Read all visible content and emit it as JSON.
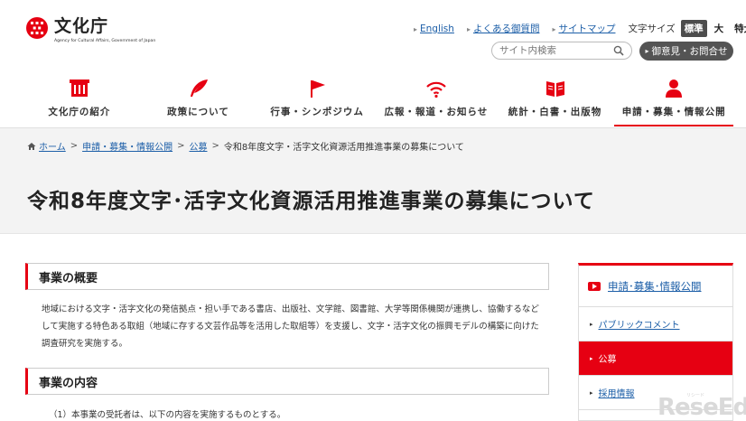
{
  "logo": {
    "jp": "文化庁",
    "en": "Agency for Cultural Affairs, Government of Japan"
  },
  "header": {
    "links": [
      "English",
      "よくある御質問",
      "サイトマップ"
    ],
    "font_size_label": "文字サイズ",
    "font_sizes": [
      "標準",
      "大",
      "特大"
    ],
    "search_placeholder": "サイト内検索",
    "opinion_button": "御意見・お問合せ"
  },
  "gnav": {
    "items": [
      {
        "label": "文化庁の紹介",
        "icon": "building-icon"
      },
      {
        "label": "政策について",
        "icon": "feather-pen-icon"
      },
      {
        "label": "行事・シンポジウム",
        "icon": "flag-icon"
      },
      {
        "label": "広報・報道・お知らせ",
        "icon": "broadcast-icon"
      },
      {
        "label": "統計・白書・出版物",
        "icon": "open-book-icon"
      },
      {
        "label": "申請・募集・情報公開",
        "icon": "person-icon"
      }
    ]
  },
  "breadcrumb": {
    "home": "ホーム",
    "level1": "申請・募集・情報公開",
    "level2": "公募",
    "current": "令和8年度文字・活字文化資源活用推進事業の募集について"
  },
  "page": {
    "title": "令和8年度文字･活字文化資源活用推進事業の募集について"
  },
  "sections": {
    "overview_heading": "事業の概要",
    "overview_text": "地域における文字・活字文化の発信拠点・担い手である書店、出版社、文学館、図書館、大学等関係機関が連携し、協働するなどして実施する特色ある取組（地域に存する文芸作品等を活用した取組等）を支援し、文字・活字文化の振興モデルの構築に向けた調査研究を実施する。",
    "content_heading": "事業の内容",
    "content_text": "（1）本事業の受託者は、以下の内容を実施するものとする。"
  },
  "sidenav": {
    "heading": "申請･募集･情報公開",
    "items": [
      "パブリックコメント",
      "公募",
      "採用情報"
    ]
  },
  "watermark": {
    "text": "ReseEd",
    "sub": "リシード"
  },
  "colors": {
    "accent": "#e60012",
    "link": "#1d5fa8"
  }
}
